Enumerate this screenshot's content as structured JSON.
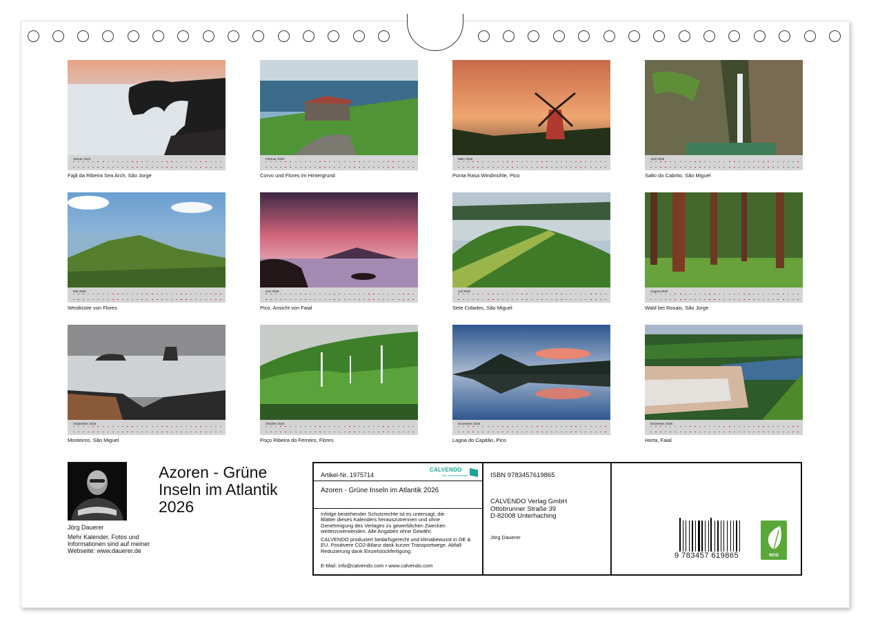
{
  "months": [
    {
      "label": "Januar 2026",
      "caption": "Fajã da Ribeira Sea Arch, São Jorge"
    },
    {
      "label": "Februar 2026",
      "caption": "Corvo und Flores im Hintergrund"
    },
    {
      "label": "März 2026",
      "caption": "Ponta Rasa Windmühle, Pico"
    },
    {
      "label": "April 2026",
      "caption": "Salto do Cabrito, São Miguel"
    },
    {
      "label": "Mai 2026",
      "caption": "Westküste von Flores"
    },
    {
      "label": "Juni 2026",
      "caption": "Pico, Ansicht von Faial"
    },
    {
      "label": "Juli 2026",
      "caption": "Sete Cidades, São Miguel"
    },
    {
      "label": "August 2026",
      "caption": "Wald bei Rosais, São Jorge"
    },
    {
      "label": "September 2026",
      "caption": "Mosteiros, São Miguel"
    },
    {
      "label": "Oktober 2026",
      "caption": "Poço Ribeira do Ferreiro, Flores"
    },
    {
      "label": "November 2026",
      "caption": "Lagoa do Capitão, Pico"
    },
    {
      "label": "Dezember 2026",
      "caption": "Horta, Faial"
    }
  ],
  "title": "Azoren - Grüne Inseln im Atlantik 2026",
  "author": {
    "name": "Jörg Dauerer",
    "info": "Mehr Kalender, Fotos und Informationen sind auf meiner Webseite: www.dauerer.de"
  },
  "publisher_box": {
    "article_no": "Artikel-Nr. 1975714",
    "logo_text": "CALVENDO",
    "logo_sub": "Ihre Wunschkalender",
    "product_title": "Azoren - Grüne Inseln im Atlantik 2026",
    "legal": "Infolge bestehender Schutzrechte ist es untersagt, die Blätter dieses Kalenders herauszutrennen und ohne Genehmigung des Verlages zu gewerblichen Zwecken weiterzuverwenden. Alle Angaben ohne Gewähr.",
    "eco_note": "CALVENDO produziert bedarfsgerecht und klimabewusst in DE & EU. Positivere CO2-Bilanz dank kurzer Transportwege. Abfall-Reduzierung dank Einzelstückfertigung.",
    "contact": "E-Mail: info@calvendo.com • www.calvendo.com"
  },
  "isbn_box": {
    "isbn": "ISBN 9783457619865",
    "publisher_lines": [
      "CALVENDO Verlag GmbH",
      "Ottobrunner Straße 39",
      "D-82008 Unterhaching"
    ],
    "author": "Jörg Dauerer"
  },
  "barcode": {
    "digits": "9 783457 619865",
    "eco_label": "eco"
  },
  "colors": {
    "calendar_strip": "#d4d4d4",
    "weekend": "#c03030",
    "eco_green": "#5aa83a",
    "calvendo_teal": "#1aa29a"
  }
}
